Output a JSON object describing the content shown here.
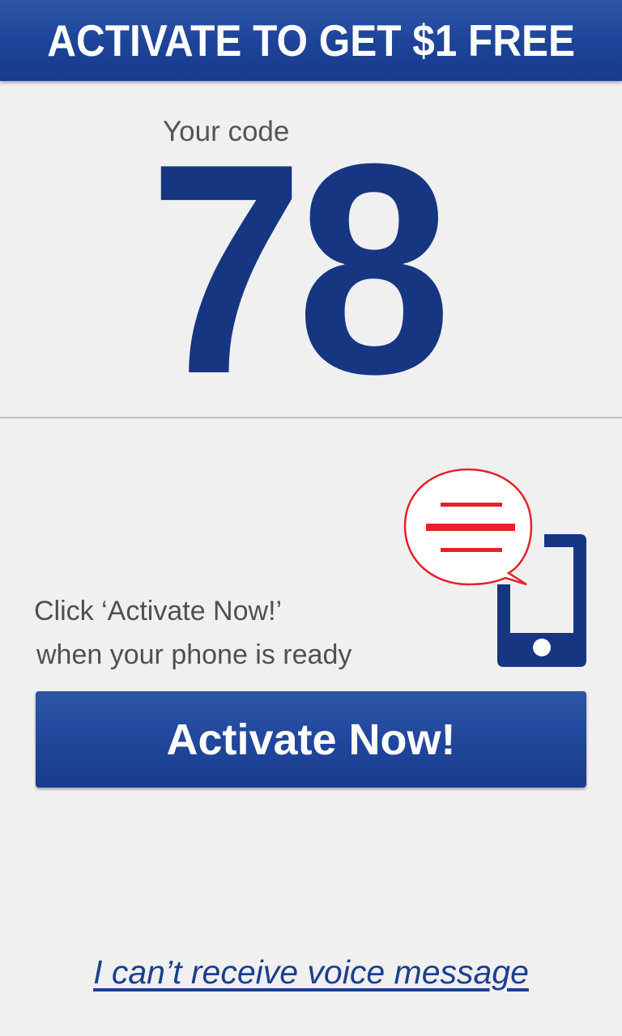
{
  "header": {
    "title": "ACTIVATE TO GET $1 FREE"
  },
  "code": {
    "label": "Your code",
    "value": "78"
  },
  "instruction": {
    "line1": "Click ‘Activate Now!’",
    "line2": "when your phone is ready"
  },
  "activate_button": {
    "label": "Activate Now!"
  },
  "voice_link": {
    "label": "I can’t receive voice message"
  },
  "illustration": {
    "icons": [
      "speech-bubble-icon",
      "smartphone-icon"
    ]
  },
  "colors": {
    "brand_blue": "#163682",
    "header_blue": "#1d4398",
    "accent_red": "#e3232b",
    "background": "#f0f0f0",
    "text_gray": "#505050"
  }
}
